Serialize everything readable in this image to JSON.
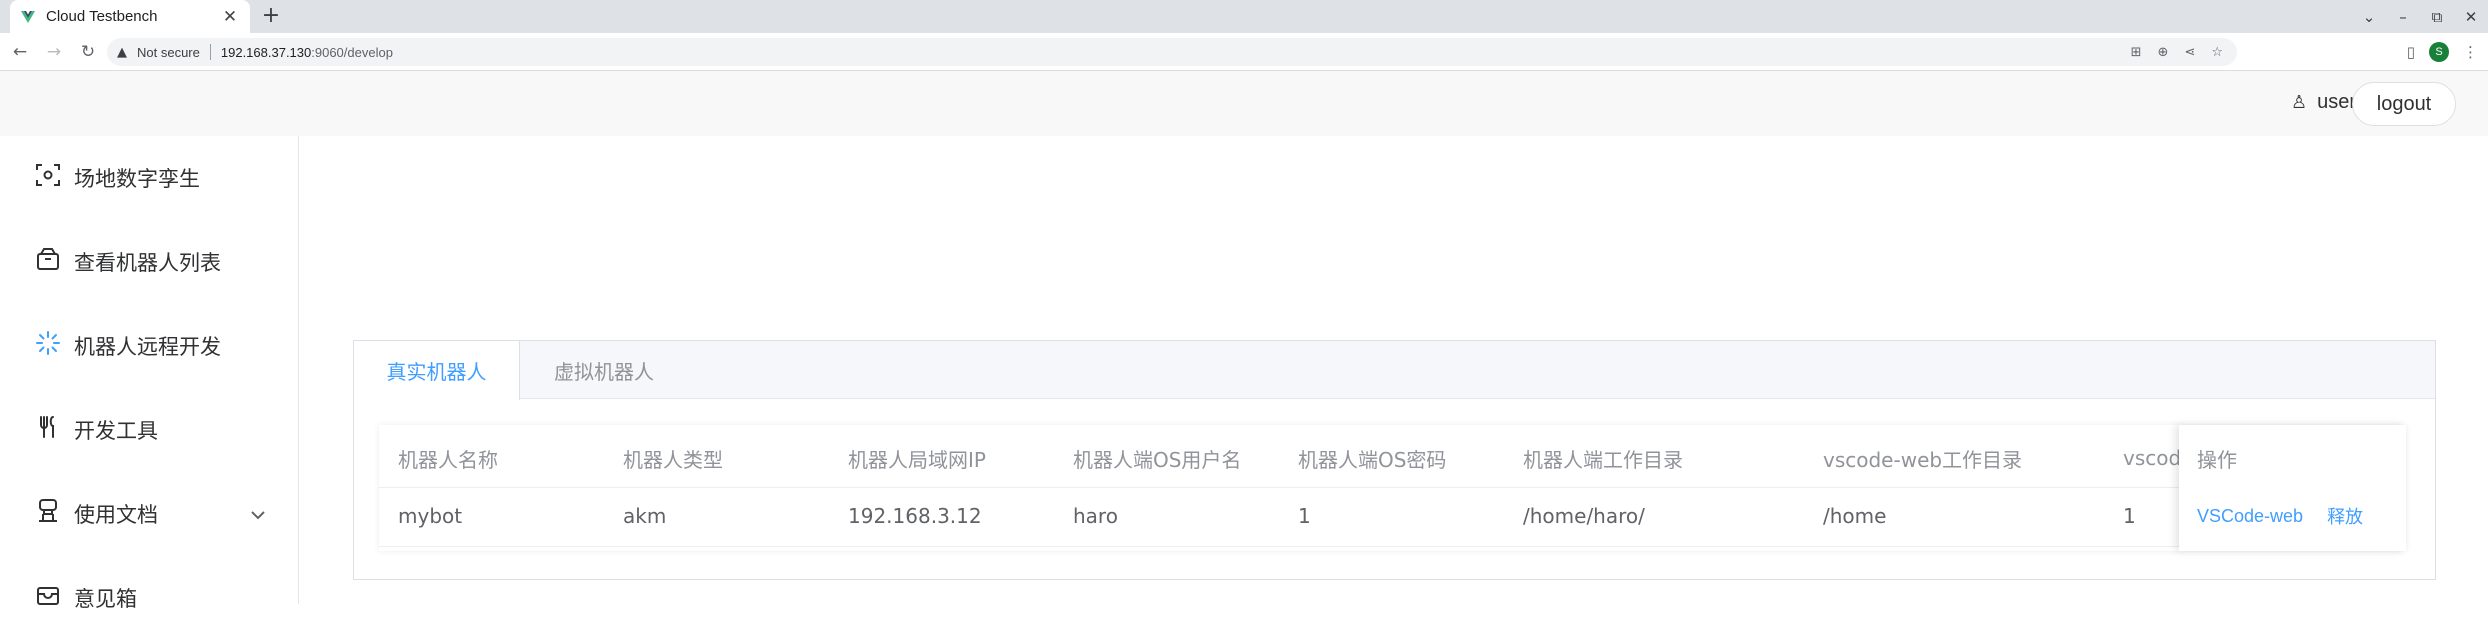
{
  "browser": {
    "tab_title": "Cloud Testbench",
    "new_tab_glyph": "+",
    "close_glyph": "✕",
    "security_label": "Not secure",
    "url_host": "192.168.37.130",
    "url_rest": ":9060/develop",
    "profile_initial": "S",
    "profile_color": "#188038"
  },
  "header": {
    "user_label": "user",
    "logout_label": "logout"
  },
  "sidebar": {
    "items": [
      {
        "label": "场地数字孪生",
        "icon": "scan-icon"
      },
      {
        "label": "查看机器人列表",
        "icon": "box-icon"
      },
      {
        "label": "机器人远程开发",
        "icon": "loading-icon"
      },
      {
        "label": "开发工具",
        "icon": "fork-spoon-icon"
      },
      {
        "label": "使用文档",
        "icon": "document-icon"
      },
      {
        "label": "意见箱",
        "icon": "mailbox-icon"
      }
    ]
  },
  "tabs": {
    "items": [
      {
        "label": "真实机器人",
        "active": true
      },
      {
        "label": "虚拟机器人",
        "active": false
      }
    ]
  },
  "table": {
    "columns": [
      "机器人名称",
      "机器人类型",
      "机器人局域网IP",
      "机器人端OS用户名",
      "机器人端OS密码",
      "机器人端工作目录",
      "vscode-web工作目录",
      "vscod"
    ],
    "rows": [
      [
        "mybot",
        "akm",
        "192.168.3.12",
        "haro",
        "1",
        "/home/haro/",
        "/home",
        "1"
      ]
    ],
    "ops_header": "操作",
    "ops": [
      "VSCode-web",
      "释放"
    ]
  },
  "colors": {
    "accent": "#409eff",
    "text_primary": "#303133",
    "text_secondary": "#909399"
  }
}
